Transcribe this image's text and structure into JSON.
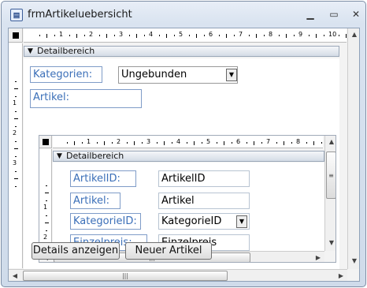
{
  "window": {
    "title": "frmArtikeluebersicht",
    "icon": "form-icon",
    "minimize": "▭",
    "restore": "□",
    "close": "✕"
  },
  "ruler": {
    "top_numbers": [
      "1",
      "2",
      "3",
      "4",
      "5",
      "6",
      "7",
      "8",
      "9",
      "10"
    ],
    "left_numbers": [
      "1",
      "2",
      "3"
    ]
  },
  "main": {
    "section_label": "Detailbereich",
    "kategorien_label": "Kategorien:",
    "kategorien_combo": "Ungebunden",
    "artikel_label": "Artikel:",
    "buttons": {
      "details": "Details anzeigen",
      "neuer": "Neuer Artikel"
    }
  },
  "subform": {
    "ruler_numbers": [
      "1",
      "2",
      "3",
      "4",
      "5",
      "6",
      "7",
      "8"
    ],
    "left_numbers": [
      "1",
      "2"
    ],
    "section_label": "Detailbereich",
    "fields": [
      {
        "label": "ArtikelID:",
        "value": "ArtikelID"
      },
      {
        "label": "Artikel:",
        "value": "Artikel"
      },
      {
        "label": "KategorieID:",
        "value": "KategorieID"
      },
      {
        "label": "Einzelpreis:",
        "value": "Einzelpreis"
      }
    ]
  }
}
